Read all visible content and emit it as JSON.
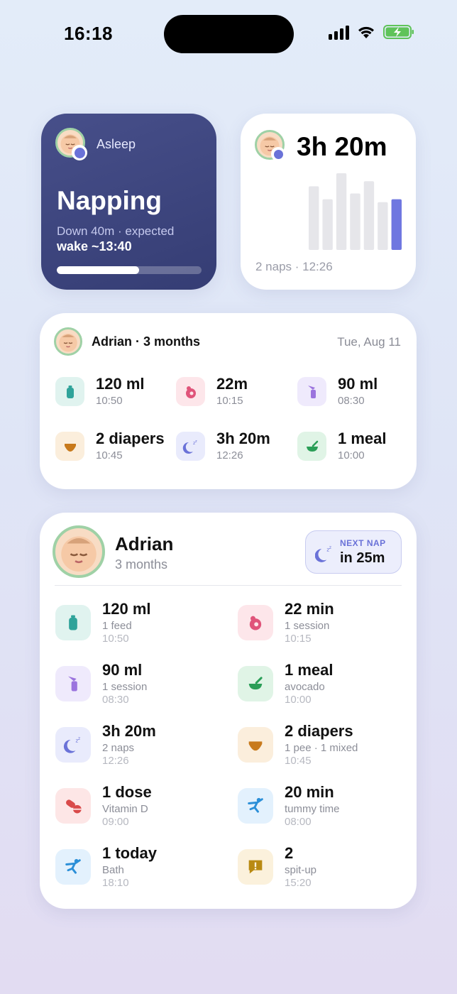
{
  "status_bar": {
    "time": "16:18"
  },
  "napping_widget": {
    "status_label": "Asleep",
    "title": "Napping",
    "detail_line1": "Down 40m · expected",
    "detail_line2": "wake ~13:40",
    "progress_percent": 57
  },
  "sleep_widget": {
    "total": "3h 20m",
    "footer": "2 naps · 12:26",
    "chart_data": {
      "type": "bar",
      "values": [
        88,
        70,
        106,
        78,
        95,
        66,
        70
      ],
      "highlight_index": 6,
      "colors": {
        "default": "#e6e6ea",
        "highlight": "#6f77e0"
      }
    }
  },
  "summary_widget": {
    "child": "Adrian · 3 months",
    "date": "Tue, Aug 11",
    "stats": [
      {
        "icon": "bottle-icon",
        "value": "120 ml",
        "time": "10:50"
      },
      {
        "icon": "breastfeed-icon",
        "value": "22m",
        "time": "10:15"
      },
      {
        "icon": "pump-icon",
        "value": "90 ml",
        "time": "08:30"
      },
      {
        "icon": "diaper-icon",
        "value": "2 diapers",
        "time": "10:45"
      },
      {
        "icon": "sleep-icon",
        "value": "3h 20m",
        "time": "12:26"
      },
      {
        "icon": "solid-food-icon",
        "value": "1 meal",
        "time": "10:00"
      }
    ]
  },
  "detail_widget": {
    "name": "Adrian",
    "age": "3 months",
    "next_nap": {
      "label": "NEXT NAP",
      "value": "in 25m"
    },
    "rows": [
      {
        "icon": "bottle-icon",
        "value": "120 ml",
        "sub": "1 feed",
        "time": "10:50"
      },
      {
        "icon": "breastfeed-icon",
        "value": "22 min",
        "sub": "1 session",
        "time": "10:15"
      },
      {
        "icon": "pump-icon",
        "value": "90 ml",
        "sub": "1 session",
        "time": "08:30"
      },
      {
        "icon": "solid-food-icon",
        "value": "1 meal",
        "sub": "avocado",
        "time": "10:00"
      },
      {
        "icon": "sleep-icon",
        "value": "3h 20m",
        "sub": "2 naps",
        "time": "12:26"
      },
      {
        "icon": "diaper-icon",
        "value": "2 diapers",
        "sub": "1 pee · 1 mixed",
        "time": "10:45"
      },
      {
        "icon": "medicine-icon",
        "value": "1 dose",
        "sub": "Vitamin D",
        "time": "09:00"
      },
      {
        "icon": "tummy-time-icon",
        "value": "20 min",
        "sub": "tummy time",
        "time": "08:00"
      },
      {
        "icon": "bath-icon",
        "value": "1 today",
        "sub": "Bath",
        "time": "18:10"
      },
      {
        "icon": "spit-up-icon",
        "value": "2",
        "sub": "spit-up",
        "time": "15:20"
      }
    ]
  }
}
